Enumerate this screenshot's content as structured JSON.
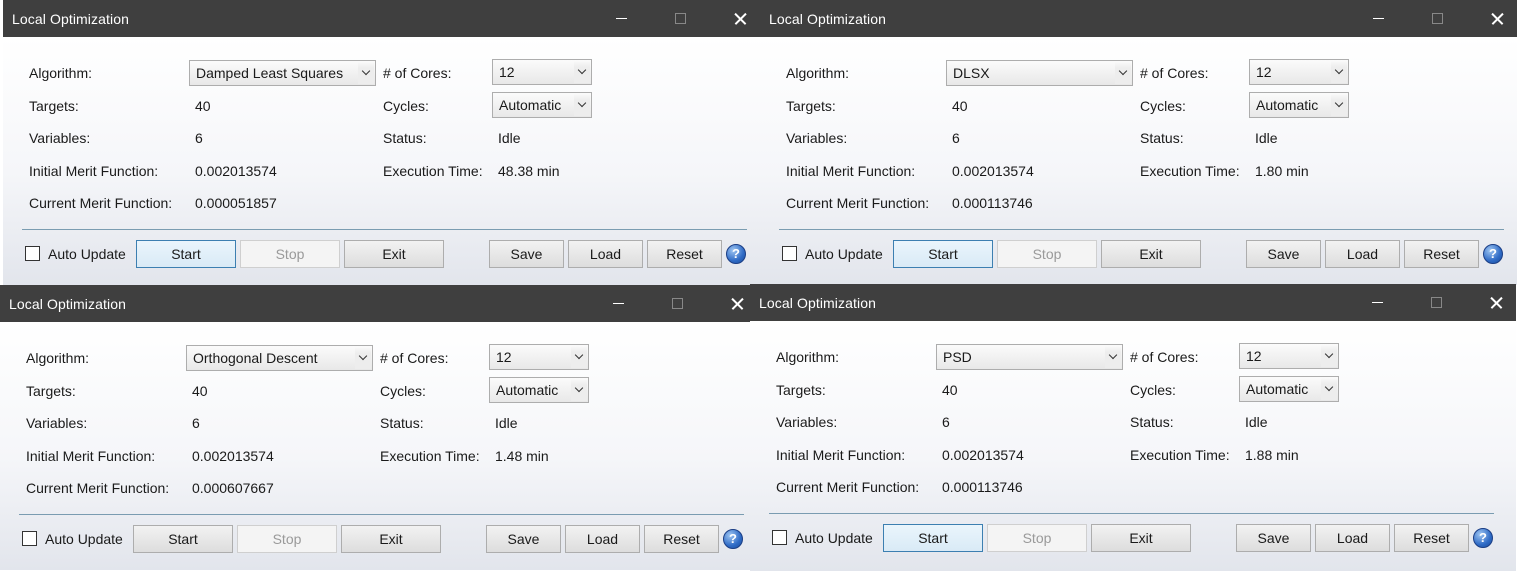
{
  "windows": [
    {
      "title": "Local Optimization",
      "labels": {
        "algorithm": "Algorithm:",
        "targets": "Targets:",
        "variables": "Variables:",
        "initial_merit": "Initial Merit Function:",
        "current_merit": "Current Merit Function:",
        "cores": "# of Cores:",
        "cycles": "Cycles:",
        "status": "Status:",
        "execution_time": "Execution Time:"
      },
      "algorithm": "Damped Least Squares",
      "targets": "40",
      "variables": "6",
      "initial_merit": "0.002013574",
      "current_merit": "0.000051857",
      "cores": "12",
      "cycles": "Automatic",
      "status": "Idle",
      "execution_time": "48.38 min",
      "auto_update": "Auto Update",
      "buttons": {
        "start": "Start",
        "stop": "Stop",
        "exit": "Exit",
        "save": "Save",
        "load": "Load",
        "reset": "Reset"
      },
      "help": "?"
    },
    {
      "title": "Local Optimization",
      "labels": {
        "algorithm": "Algorithm:",
        "targets": "Targets:",
        "variables": "Variables:",
        "initial_merit": "Initial Merit Function:",
        "current_merit": "Current Merit Function:",
        "cores": "# of Cores:",
        "cycles": "Cycles:",
        "status": "Status:",
        "execution_time": "Execution Time:"
      },
      "algorithm": "DLSX",
      "targets": "40",
      "variables": "6",
      "initial_merit": "0.002013574",
      "current_merit": "0.000113746",
      "cores": "12",
      "cycles": "Automatic",
      "status": "Idle",
      "execution_time": "1.80 min",
      "auto_update": "Auto Update",
      "buttons": {
        "start": "Start",
        "stop": "Stop",
        "exit": "Exit",
        "save": "Save",
        "load": "Load",
        "reset": "Reset"
      },
      "help": "?"
    },
    {
      "title": "Local Optimization",
      "labels": {
        "algorithm": "Algorithm:",
        "targets": "Targets:",
        "variables": "Variables:",
        "initial_merit": "Initial Merit Function:",
        "current_merit": "Current Merit Function:",
        "cores": "# of Cores:",
        "cycles": "Cycles:",
        "status": "Status:",
        "execution_time": "Execution Time:"
      },
      "algorithm": "Orthogonal Descent",
      "targets": "40",
      "variables": "6",
      "initial_merit": "0.002013574",
      "current_merit": "0.000607667",
      "cores": "12",
      "cycles": "Automatic",
      "status": "Idle",
      "execution_time": "1.48 min",
      "auto_update": "Auto Update",
      "buttons": {
        "start": "Start",
        "stop": "Stop",
        "exit": "Exit",
        "save": "Save",
        "load": "Load",
        "reset": "Reset"
      },
      "help": "?"
    },
    {
      "title": "Local Optimization",
      "labels": {
        "algorithm": "Algorithm:",
        "targets": "Targets:",
        "variables": "Variables:",
        "initial_merit": "Initial Merit Function:",
        "current_merit": "Current Merit Function:",
        "cores": "# of Cores:",
        "cycles": "Cycles:",
        "status": "Status:",
        "execution_time": "Execution Time:"
      },
      "algorithm": "PSD",
      "targets": "40",
      "variables": "6",
      "initial_merit": "0.002013574",
      "current_merit": "0.000113746",
      "cores": "12",
      "cycles": "Automatic",
      "status": "Idle",
      "execution_time": "1.88 min",
      "auto_update": "Auto Update",
      "buttons": {
        "start": "Start",
        "stop": "Stop",
        "exit": "Exit",
        "save": "Save",
        "load": "Load",
        "reset": "Reset"
      },
      "help": "?"
    }
  ],
  "colors": {
    "titlebar": "#3f3f3f",
    "separator": "#7a9cb1",
    "default_button_border": "#3c7fb1",
    "help_icon": "#2f6bc6"
  }
}
